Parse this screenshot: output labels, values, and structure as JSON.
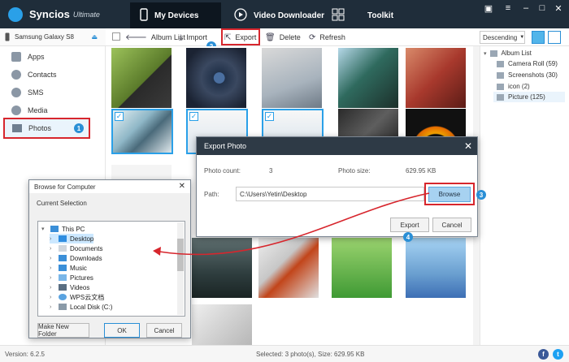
{
  "app": {
    "name": "Syncios",
    "edition": "Ultimate"
  },
  "nav": {
    "tabs": [
      {
        "label": "My Devices"
      },
      {
        "label": "Video Downloader"
      },
      {
        "label": "Toolkit"
      }
    ]
  },
  "device": {
    "name": "Samsung Galaxy S8"
  },
  "sidebar": {
    "items": [
      {
        "label": "Apps"
      },
      {
        "label": "Contacts"
      },
      {
        "label": "SMS"
      },
      {
        "label": "Media"
      },
      {
        "label": "Photos"
      }
    ]
  },
  "toolbar": {
    "album_list": "Album List",
    "import": "Import",
    "export": "Export",
    "delete": "Delete",
    "refresh": "Refresh",
    "sort": "Descending"
  },
  "albums": {
    "root": "Album List",
    "items": [
      "Camera Roll (59)",
      "Screenshots (30)",
      "icon (2)",
      "Picture (125)"
    ]
  },
  "status": {
    "version": "Version: 6.2.5",
    "selected": "Selected: 3 photo(s), Size: 629.95 KB"
  },
  "export_dialog": {
    "title": "Export Photo",
    "photo_count_label": "Photo count:",
    "photo_count": "3",
    "photo_size_label": "Photo size:",
    "photo_size": "629.95 KB",
    "path_label": "Path:",
    "path_value": "C:\\Users\\Yetin\\Desktop",
    "browse": "Browse",
    "export": "Export",
    "cancel": "Cancel"
  },
  "browse_dialog": {
    "title": "Browse for Computer",
    "subtitle": "Current Selection",
    "tree": [
      "This PC",
      "Desktop",
      "Documents",
      "Downloads",
      "Music",
      "Pictures",
      "Videos",
      "WPS云文档",
      "Local Disk (C:)"
    ],
    "make_new_folder": "Make New Folder",
    "ok": "OK",
    "cancel": "Cancel"
  },
  "steps": [
    "1",
    "2",
    "3",
    "4"
  ],
  "colors": {
    "titlebar": "#1f2d3a",
    "accent": "#2a8fd6",
    "highlight_red": "#d7262d"
  }
}
